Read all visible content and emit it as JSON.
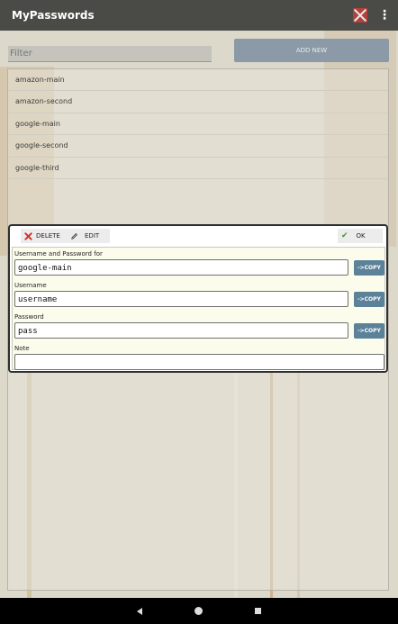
{
  "app": {
    "title": "MyPasswords"
  },
  "filter": {
    "placeholder": "Filter"
  },
  "add_new_label": "ADD NEW",
  "entries": [
    "amazon-main",
    "amazon-second",
    "google-main",
    "google-second",
    "google-third"
  ],
  "dialog": {
    "delete_label": "DELETE",
    "edit_label": "EDIT",
    "ok_label": "OK",
    "title_label": "Username and Password for",
    "title_value": "google-main",
    "username_label": "Username",
    "username_value": "username",
    "password_label": "Password",
    "password_value": "pass",
    "note_label": "Note",
    "note_value": "",
    "copy_label": "->COPY"
  },
  "colors": {
    "accent": "#5b8299",
    "appbar": "#4a4a46",
    "delete": "#d6302a",
    "ok": "#3a9a3a"
  },
  "icons": {
    "close": "close-x-icon",
    "menu": "overflow-menu-icon",
    "delete": "x-icon",
    "edit": "pencil-icon",
    "ok": "checkmark-icon"
  }
}
